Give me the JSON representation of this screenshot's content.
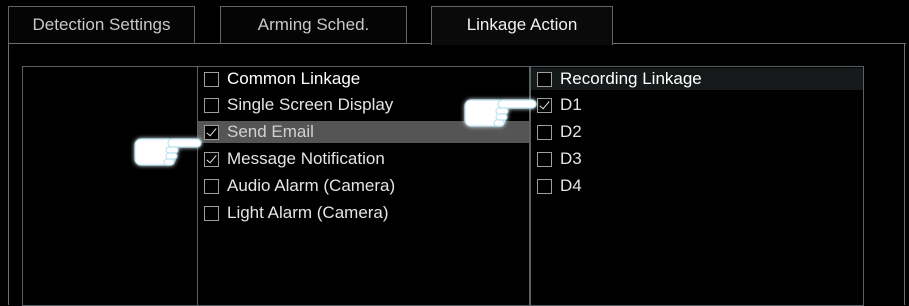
{
  "tabs": [
    {
      "label": "Detection Settings",
      "active": false
    },
    {
      "label": "Arming Sched.",
      "active": false
    },
    {
      "label": "Linkage Action",
      "active": true
    }
  ],
  "linkage_list": {
    "header": {
      "label": "Common Linkage",
      "checked": false
    },
    "items": [
      {
        "label": "Single Screen Display",
        "checked": false
      },
      {
        "label": "Send Email",
        "checked": true,
        "highlighted": true
      },
      {
        "label": "Message Notification",
        "checked": true
      },
      {
        "label": "Audio Alarm (Camera)",
        "checked": false
      },
      {
        "label": "Light Alarm (Camera)",
        "checked": false
      }
    ]
  },
  "recording_list": {
    "header": {
      "label": "Recording Linkage",
      "checked": false
    },
    "items": [
      {
        "label": "D1",
        "checked": true
      },
      {
        "label": "D2",
        "checked": false
      },
      {
        "label": "D3",
        "checked": false
      },
      {
        "label": "D4",
        "checked": false
      }
    ]
  },
  "pointers": [
    {
      "icon": "hand-pointer-icon",
      "target": "Send Email"
    },
    {
      "icon": "hand-pointer-icon",
      "target": "D1"
    }
  ],
  "colors": {
    "background": "#000000",
    "highlight": "#555555",
    "border": "#6e6e6e"
  }
}
